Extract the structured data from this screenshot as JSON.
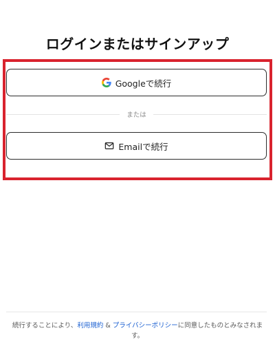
{
  "header": {
    "title": "ログインまたはサインアップ"
  },
  "auth": {
    "google_label": "Googleで続行",
    "divider_label": "または",
    "email_label": "Emailで続行"
  },
  "footer": {
    "text_before": "続行することにより、",
    "terms_link": "利用規約",
    "ampersand": " & ",
    "privacy_link": "プライバシーポリシー",
    "text_after": "に同意したものとみなされます。"
  },
  "colors": {
    "highlight_border": "#d9232e",
    "link": "#1a5fd1"
  },
  "icons": {
    "google": "google-icon",
    "email": "mail-icon"
  }
}
